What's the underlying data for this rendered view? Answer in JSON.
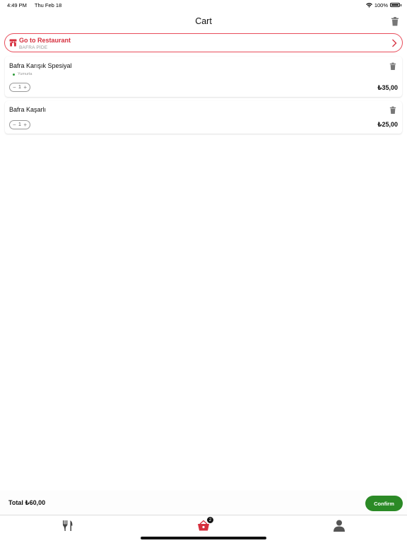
{
  "status_bar": {
    "time": "4:49 PM",
    "date": "Thu Feb 18",
    "battery": "100%"
  },
  "header": {
    "title": "Cart"
  },
  "restaurant": {
    "title": "Go to Restaurant",
    "name": "BAFRA PİDE"
  },
  "cart_items": [
    {
      "name": "Bafra Karışık Spesiyal",
      "option": "Yumurta",
      "quantity": "1",
      "price": "₺35,00"
    },
    {
      "name": "Bafra Kaşarlı",
      "option": "",
      "quantity": "1",
      "price": "₺25,00"
    }
  ],
  "stepper": {
    "minus": "−",
    "plus": "+"
  },
  "footer": {
    "total": "Total ₺60,00",
    "confirm_label": "Confirm"
  },
  "tab_bar": {
    "cart_badge": "2",
    "items": [
      "restaurants-icon",
      "cart-icon",
      "profile-icon"
    ]
  },
  "colors": {
    "accent_red": "#d62f3e",
    "confirm_green": "#2b8a26",
    "badge": "#111111"
  }
}
